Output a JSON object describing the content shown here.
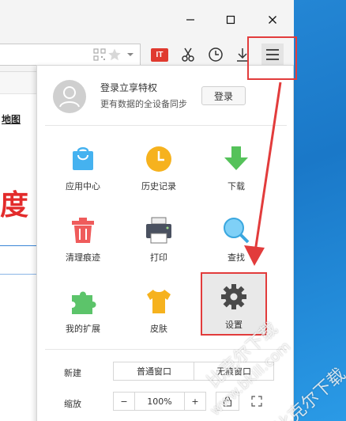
{
  "window": {
    "min_glyph": "—",
    "max_glyph": "☐",
    "close_glyph": "✕"
  },
  "page": {
    "map_link": "地图",
    "brand_fragment": "度"
  },
  "toolbar": {
    "it_badge": "IT"
  },
  "account": {
    "title": "登录立享特权",
    "subtitle": "更有数据的全设备同步",
    "login_button": "登录"
  },
  "grid": [
    {
      "label": "应用中心",
      "icon": "app-center-bag-icon"
    },
    {
      "label": "历史记录",
      "icon": "history-clock-icon"
    },
    {
      "label": "下载",
      "icon": "download-arrow-icon"
    },
    {
      "label": "清理痕迹",
      "icon": "trash-icon"
    },
    {
      "label": "打印",
      "icon": "printer-icon"
    },
    {
      "label": "查找",
      "icon": "magnifier-icon"
    },
    {
      "label": "我的扩展",
      "icon": "puzzle-icon"
    },
    {
      "label": "皮肤",
      "icon": "tshirt-icon"
    },
    {
      "label": "设置",
      "icon": "gear-icon"
    }
  ],
  "new_row": {
    "label": "新建",
    "normal_window": "普通窗口",
    "private_window": "无痕窗口"
  },
  "zoom_row": {
    "label": "缩放",
    "minus": "−",
    "value": "100%",
    "plus": "+"
  },
  "watermark": {
    "line1": "比克尔下载",
    "line2": "www.bkill.com",
    "line3": "比克尔下载"
  },
  "colors": {
    "highlight_red": "#e23c3c",
    "brand_red": "#e32b2b",
    "desktop_blue": "#1f86d8"
  }
}
